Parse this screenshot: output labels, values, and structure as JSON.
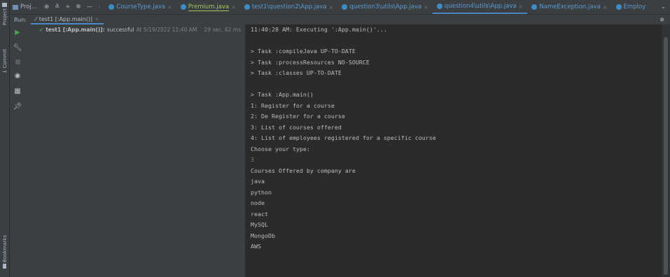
{
  "left_strip": {
    "project_label": "Project",
    "commit_label": "Commit",
    "bookmarks_label": "Bookmarks"
  },
  "tabbar": {
    "project_label": "Proj...",
    "tabs": [
      {
        "label": "CourseType.java",
        "color": "#5aa9e6"
      },
      {
        "label": "Premium.java",
        "color": "#5aa9e6"
      },
      {
        "label": "test1\\question2\\App.java",
        "color": "#5aa9e6"
      },
      {
        "label": "question3\\utils\\App.java",
        "color": "#5aa9e6"
      },
      {
        "label": "question4\\utils\\App.java",
        "color": "#5aa9e6",
        "active": true
      },
      {
        "label": "NameException.java",
        "color": "#5aa9e6"
      },
      {
        "label": "Employ",
        "color": "#5aa9e6"
      }
    ]
  },
  "run": {
    "label": "Run:",
    "tab_label": "test1 [:App.main()]",
    "tree_item": {
      "name": "test1 [:App.main()]:",
      "status": "successful",
      "time": "At 5/19/2022 11:40 AM",
      "duration": "29 sec, 62 ms"
    }
  },
  "console": {
    "lines": [
      {
        "text": "11:40:28 AM: Executing ':App.main()'...",
        "kind": "normal"
      },
      {
        "text": "",
        "kind": "normal"
      },
      {
        "text": "> Task :compileJava UP-TO-DATE",
        "kind": "normal"
      },
      {
        "text": "> Task :processResources NO-SOURCE",
        "kind": "normal"
      },
      {
        "text": "> Task :classes UP-TO-DATE",
        "kind": "normal"
      },
      {
        "text": "",
        "kind": "normal"
      },
      {
        "text": "> Task :App.main()",
        "kind": "normal"
      },
      {
        "text": "1: Register for a course",
        "kind": "normal"
      },
      {
        "text": "2: De Register for a course",
        "kind": "normal"
      },
      {
        "text": "3: List of courses offered",
        "kind": "normal"
      },
      {
        "text": "4: List of employees registered for a specific course",
        "kind": "normal"
      },
      {
        "text": "Choose your type:",
        "kind": "normal"
      },
      {
        "text": "3",
        "kind": "input"
      },
      {
        "text": "Courses Offered by company are",
        "kind": "normal"
      },
      {
        "text": "java",
        "kind": "normal"
      },
      {
        "text": "python",
        "kind": "normal"
      },
      {
        "text": "node",
        "kind": "normal"
      },
      {
        "text": "react",
        "kind": "normal"
      },
      {
        "text": "MySQL",
        "kind": "normal"
      },
      {
        "text": "MongoDb",
        "kind": "normal"
      },
      {
        "text": "AWS",
        "kind": "normal"
      }
    ]
  }
}
